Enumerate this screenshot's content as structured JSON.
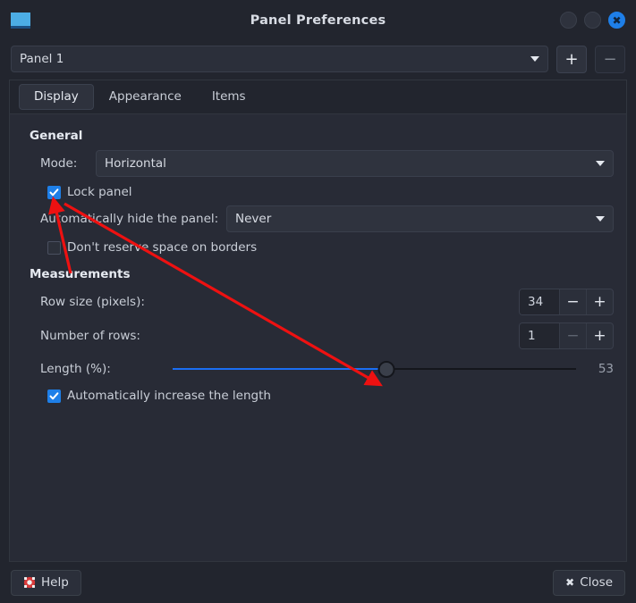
{
  "window": {
    "title": "Panel Preferences",
    "app_icon": "panel-icon",
    "controls": {
      "minimize": "",
      "maximize": "",
      "close": "✖"
    }
  },
  "selector": {
    "current_panel": "Panel 1",
    "add_label": "+",
    "remove_label": "−"
  },
  "tabs": [
    {
      "label": "Display",
      "active": true
    },
    {
      "label": "Appearance",
      "active": false
    },
    {
      "label": "Items",
      "active": false
    }
  ],
  "general": {
    "heading": "General",
    "mode_label": "Mode:",
    "mode_value": "Horizontal",
    "lock_panel_label": "Lock panel",
    "lock_panel_checked": true,
    "autohide_label": "Automatically hide the panel:",
    "autohide_value": "Never",
    "no_reserve_label": "Don't reserve space on borders",
    "no_reserve_checked": false
  },
  "measurements": {
    "heading": "Measurements",
    "row_size_label": "Row size (pixels):",
    "row_size_value": "34",
    "num_rows_label": "Number of rows:",
    "num_rows_value": "1",
    "length_label": "Length (%):",
    "length_value": "53",
    "auto_length_label": "Automatically increase the length",
    "auto_length_checked": true,
    "minus_label": "−",
    "plus_label": "+"
  },
  "footer": {
    "help_label": "Help",
    "close_label": "Close",
    "close_icon": "✖"
  },
  "colors": {
    "accent": "#1e7fe8",
    "slider_fill": "#1b6ef3",
    "window_bg": "#22252e",
    "content_bg": "#282b36",
    "annotation": "#ee1111",
    "app_icon": "#4cade5"
  }
}
